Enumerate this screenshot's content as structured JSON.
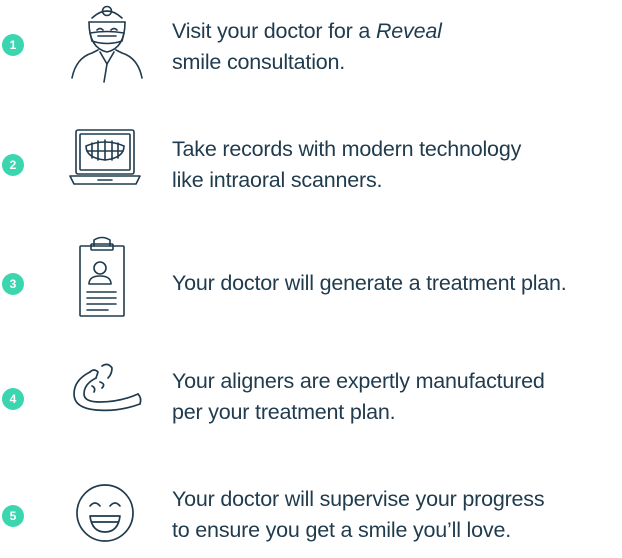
{
  "accent_color": "#3bd6b0",
  "text_color": "#1f3b4d",
  "icon_color": "#1f3b4d",
  "steps": [
    {
      "number": "1",
      "icon": "doctor-icon",
      "text_before": "Visit your doctor for a ",
      "text_emphasis": "Reveal",
      "text_line2": "smile consultation."
    },
    {
      "number": "2",
      "icon": "laptop-scan-icon",
      "text_line1": "Take records with modern technology",
      "text_line2": "like intraoral scanners."
    },
    {
      "number": "3",
      "icon": "clipboard-icon",
      "text_line1": "Your doctor will generate a treatment plan."
    },
    {
      "number": "4",
      "icon": "aligner-icon",
      "text_line1": "Your aligners are expertly manufactured",
      "text_line2": "per your treatment plan."
    },
    {
      "number": "5",
      "icon": "smile-face-icon",
      "text_line1": "Your doctor will supervise your progress",
      "text_line2": "to ensure you get a smile you’ll love."
    }
  ]
}
